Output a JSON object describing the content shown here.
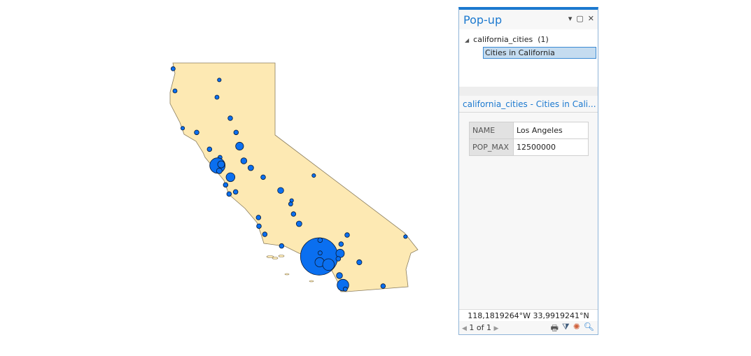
{
  "colors": {
    "land": "#fde9b3",
    "city": "#0a6ff0",
    "accent": "#1c79cf"
  },
  "popup": {
    "title": "Pop-up",
    "layer_label": "california_cities",
    "layer_count": "(1)",
    "selected_item": "Cities in California",
    "feature_title": "california_cities - Cities in Cali...",
    "fields": [
      {
        "key": "NAME",
        "value": "Los Angeles"
      },
      {
        "key": "POP_MAX",
        "value": "12500000"
      }
    ],
    "coordinates": "118,1819264°W 33,9919241°N",
    "page": "1 of 1",
    "icons": [
      "print-icon",
      "filter-icon",
      "flash-icon",
      "zoom-to-icon"
    ]
  }
}
